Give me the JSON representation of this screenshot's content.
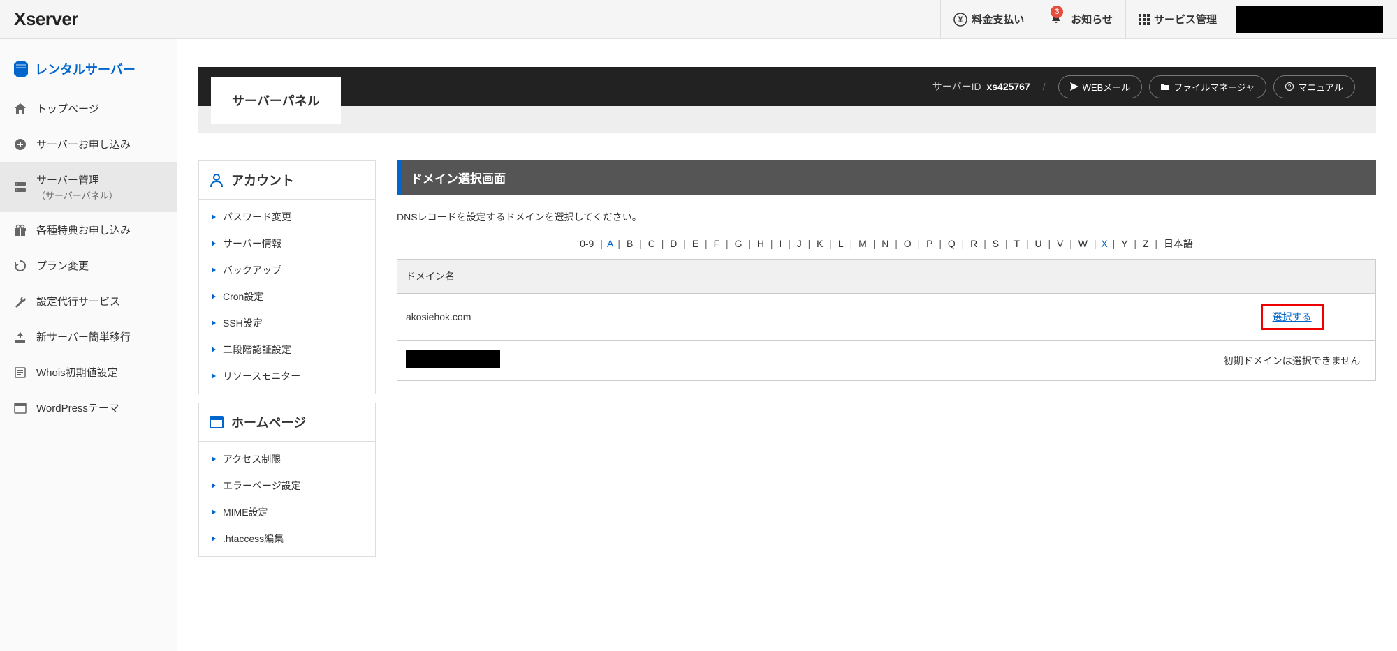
{
  "header": {
    "logo_text": "server",
    "nav": {
      "payment": "料金支払い",
      "notices": "お知らせ",
      "notice_count": "3",
      "service_mgmt": "サービス管理"
    }
  },
  "sidebar": {
    "heading": "レンタルサーバー",
    "items": [
      {
        "label": "トップページ"
      },
      {
        "label": "サーバーお申し込み"
      },
      {
        "label": "サーバー管理",
        "sublabel": "（サーバーパネル）"
      },
      {
        "label": "各種特典お申し込み"
      },
      {
        "label": "プラン変更"
      },
      {
        "label": "設定代行サービス"
      },
      {
        "label": "新サーバー簡単移行"
      },
      {
        "label": "Whois初期値設定"
      },
      {
        "label": "WordPressテーマ"
      }
    ]
  },
  "server_bar": {
    "panel_title": "サーバーパネル",
    "server_id_label": "サーバーID",
    "server_id_value": "xs425767",
    "buttons": {
      "webmail": "WEBメール",
      "filemanager": "ファイルマネージャ",
      "manual": "マニュアル"
    }
  },
  "left_panel": {
    "account": {
      "title": "アカウント",
      "links": [
        "パスワード変更",
        "サーバー情報",
        "バックアップ",
        "Cron設定",
        "SSH設定",
        "二段階認証設定",
        "リソースモニター"
      ]
    },
    "homepage": {
      "title": "ホームページ",
      "links": [
        "アクセス制限",
        "エラーページ設定",
        "MIME設定",
        ".htaccess編集"
      ]
    }
  },
  "main": {
    "page_title": "ドメイン選択画面",
    "description": "DNSレコードを設定するドメインを選択してください。",
    "alpha_index": {
      "prefix": "0-9",
      "letters": [
        "A",
        "B",
        "C",
        "D",
        "E",
        "F",
        "G",
        "H",
        "I",
        "J",
        "K",
        "L",
        "M",
        "N",
        "O",
        "P",
        "Q",
        "R",
        "S",
        "T",
        "U",
        "V",
        "W",
        "X",
        "Y",
        "Z"
      ],
      "link_letters": [
        "A",
        "X"
      ],
      "suffix": "日本語"
    },
    "table": {
      "col_header": "ドメイン名",
      "rows": [
        {
          "domain": "akosiehok.com",
          "action": "選択する",
          "highlighted": true
        },
        {
          "domain": "",
          "redacted": true,
          "action": "初期ドメインは選択できません"
        }
      ]
    }
  }
}
